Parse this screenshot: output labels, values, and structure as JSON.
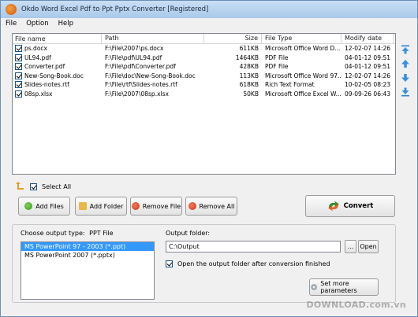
{
  "window": {
    "title": "Okdo Word Excel Pdf to Ppt Pptx Converter [Registered]"
  },
  "menu": [
    "File",
    "Option",
    "Help"
  ],
  "file_list": {
    "columns": [
      "File name",
      "Path",
      "Size",
      "File Type",
      "Modify date"
    ],
    "rows": [
      {
        "checked": true,
        "name": "ps.docx",
        "path": "F:\\File\\2007\\ps.docx",
        "size": "611KB",
        "type": "Microsoft Office Word D...",
        "date": "12-02-07 14:26"
      },
      {
        "checked": true,
        "name": "UL94.pdf",
        "path": "F:\\File\\pdf\\UL94.pdf",
        "size": "1464KB",
        "type": "PDF File",
        "date": "04-01-12 09:51"
      },
      {
        "checked": true,
        "name": "Converter.pdf",
        "path": "F:\\File\\pdf\\Converter.pdf",
        "size": "428KB",
        "type": "PDF File",
        "date": "04-01-12 09:51"
      },
      {
        "checked": true,
        "name": "New-Song-Book.doc",
        "path": "F:\\File\\doc\\New-Song-Book.doc",
        "size": "113KB",
        "type": "Microsoft Office Word 97...",
        "date": "12-02-07 14:26"
      },
      {
        "checked": true,
        "name": "Slides-notes.rtf",
        "path": "F:\\File\\rtf\\Slides-notes.rtf",
        "size": "618KB",
        "type": "Rich Text Format",
        "date": "10-02-05 08:23"
      },
      {
        "checked": true,
        "name": "08sp.xlsx",
        "path": "F:\\File\\2007\\08sp.xlsx",
        "size": "50KB",
        "type": "Microsoft Office Excel W...",
        "date": "09-09-26 06:43"
      }
    ]
  },
  "select_all": {
    "label": "Select All",
    "checked": true
  },
  "buttons": {
    "add_files": "Add Files",
    "add_folder": "Add Folder",
    "remove_file": "Remove File",
    "remove_all": "Remove All",
    "convert": "Convert"
  },
  "output": {
    "type_label": "Choose output type:",
    "type_value": "PPT File",
    "types": [
      "MS PowerPoint 97 - 2003 (*.ppt)",
      "MS PowerPoint 2007 (*.pptx)"
    ],
    "folder_label": "Output folder:",
    "folder_value": "C:\\Output",
    "browse_label": "...",
    "open_label": "Open",
    "open_after_label": "Open the output folder after conversion finished",
    "open_after_checked": true,
    "params_label": "Set more parameters"
  },
  "watermark": "DOWNLOAD.com.vn",
  "colors": {
    "selection": "#3399ff",
    "title_bar": "#a9c8ea"
  }
}
